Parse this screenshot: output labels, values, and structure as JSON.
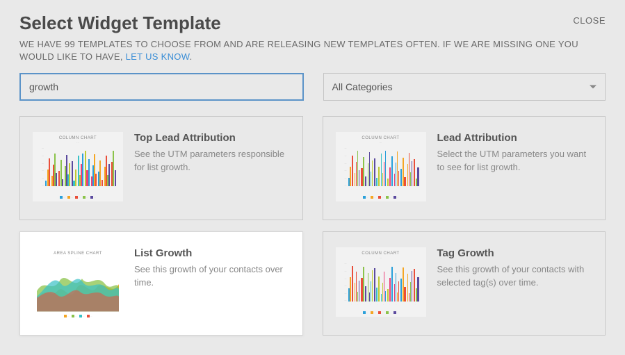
{
  "dialog": {
    "title": "Select Widget Template",
    "close_label": "CLOSE",
    "subtitle_a": "WE HAVE 99 TEMPLATES TO CHOOSE FROM AND ARE RELEASING NEW TEMPLATES OFTEN. IF WE ARE MISSING ONE YOU WOULD LIKE TO HAVE, ",
    "subtitle_link": "LET US KNOW",
    "subtitle_b": "."
  },
  "search": {
    "value": "growth",
    "placeholder": ""
  },
  "category": {
    "selected": "All Categories"
  },
  "cards": [
    {
      "title": "Top Lead Attribution",
      "description": "See the UTM parameters responsible for list growth.",
      "thumb_type": "column",
      "thumb_label": "COLUMN CHART",
      "selected": false
    },
    {
      "title": "Lead Attribution",
      "description": "Select the UTM parameters you want to see for list growth.",
      "thumb_type": "column",
      "thumb_label": "COLUMN CHART",
      "selected": false
    },
    {
      "title": "List Growth",
      "description": "See this growth of your contacts over time.",
      "thumb_type": "area",
      "thumb_label": "AREA SPLINE CHART",
      "selected": true
    },
    {
      "title": "Tag Growth",
      "description": "See this growth of your contacts with selected tag(s) over time.",
      "thumb_type": "column",
      "thumb_label": "COLUMN CHART",
      "selected": false
    }
  ],
  "thumb_colors": {
    "column": [
      "#2aa0da",
      "#f5a623",
      "#e94e3a",
      "#8bc34a",
      "#5b4a9e",
      "#39c1c6",
      "#c0ca33",
      "#ec407a"
    ],
    "area": [
      "#f5a623",
      "#8bc34a",
      "#39c1c6",
      "#e94e3a"
    ]
  }
}
